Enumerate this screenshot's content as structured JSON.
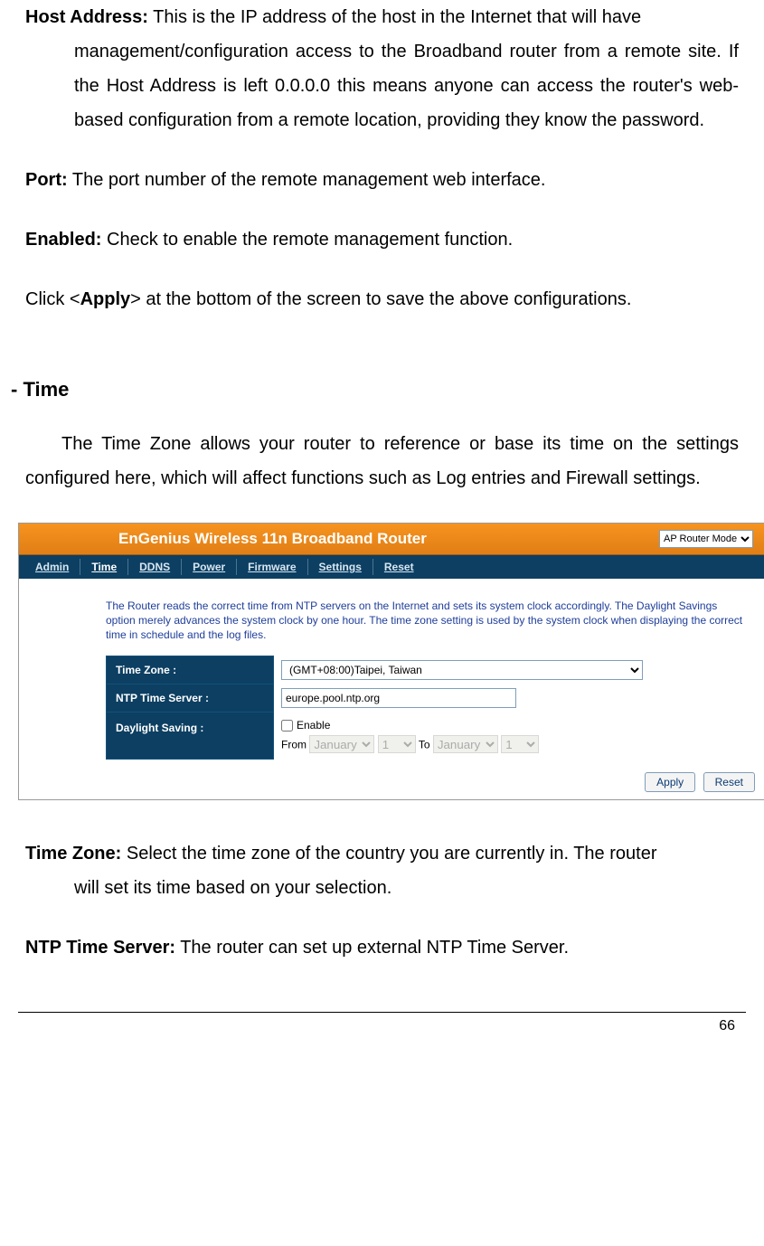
{
  "defs": {
    "host_label": "Host Address:",
    "host_text": "This is the IP address of the host in the Internet that will have management/configuration access to the Broadband router from a remote site. If the Host Address is left 0.0.0.0 this means anyone can access the router's web-based configuration from a remote location, providing they know the password.",
    "port_label": "Port:",
    "port_text": "The port number of the remote management web interface.",
    "enabled_label": "Enabled:",
    "enabled_text": "Check to enable the remote management function.",
    "apply_pre": "Click <",
    "apply_bold": "Apply",
    "apply_post": "> at the bottom of the screen to save the above configurations."
  },
  "section": {
    "title": "- Time",
    "body": "The Time Zone allows your router to reference or base its time on the settings configured here, which will affect functions such as Log entries and Firewall settings."
  },
  "shot": {
    "banner": "EnGenius Wireless 11n Broadband Router",
    "mode_sel": "AP Router Mode",
    "tabs": [
      "Admin",
      "Time",
      "DDNS",
      "Power",
      "Firmware",
      "Settings",
      "Reset"
    ],
    "desc": "The Router reads the correct time from NTP servers on the Internet and sets its system clock accordingly. The Daylight Savings option merely advances the system clock by one hour. The time zone setting is used by the system clock when displaying the correct time in schedule and the log files.",
    "tz_label": "Time Zone :",
    "tz_value": "(GMT+08:00)Taipei, Taiwan",
    "ntp_label": "NTP Time Server :",
    "ntp_value": "europe.pool.ntp.org",
    "ds_label": "Daylight Saving :",
    "ds_enable": "Enable",
    "ds_from": "From",
    "ds_to": "To",
    "ds_month": "January",
    "ds_day": "1",
    "btn_apply": "Apply",
    "btn_reset": "Reset"
  },
  "defs2": {
    "tz_label": "Time Zone:",
    "tz_text": "Select the time zone of the country you are currently in. The router will set its time based on your selection.",
    "ntp_label": "NTP Time Server:",
    "ntp_text": "The router can set up external NTP Time Server."
  },
  "page_num": "66"
}
